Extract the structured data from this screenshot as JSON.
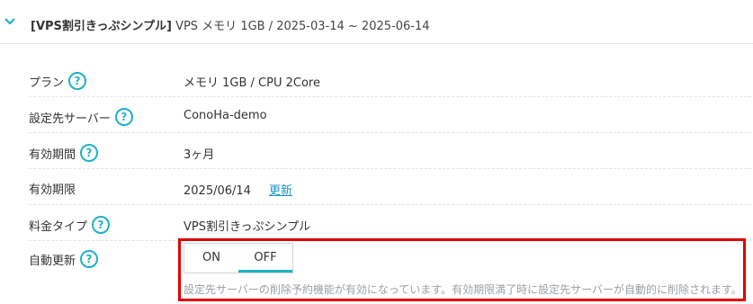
{
  "header": {
    "title_bold": "[VPS割引きっぷシンプル]",
    "title_rest": " VPS メモリ 1GB / 2025-03-14 ~ 2025-06-14"
  },
  "rows": [
    {
      "label": "プラン",
      "value": "メモリ 1GB / CPU 2Core",
      "help": "?"
    },
    {
      "label": "設定先サーバー",
      "value": "ConoHa-demo",
      "help": "?"
    },
    {
      "label": "有効期間",
      "value": "3ヶ月",
      "help": "?"
    },
    {
      "label": "有効期限",
      "value": "2025/06/14",
      "link": "更新"
    },
    {
      "label": "料金タイプ",
      "value": "VPS割引きっぷシンプル",
      "help": "?"
    }
  ],
  "auto_renew": {
    "label": "自動更新",
    "help": "?",
    "on_label": "ON",
    "off_label": "OFF",
    "selected": "OFF",
    "note": "設定先サーバーの削除予約機能が有効になっています。有効期限満了時に設定先サーバーが自動的に削除されます。"
  },
  "colors": {
    "accent": "#1cb2c8",
    "link": "#1a97c9",
    "highlight": "#e00000"
  },
  "icons": [
    "chevron-down-icon",
    "help-icon"
  ]
}
